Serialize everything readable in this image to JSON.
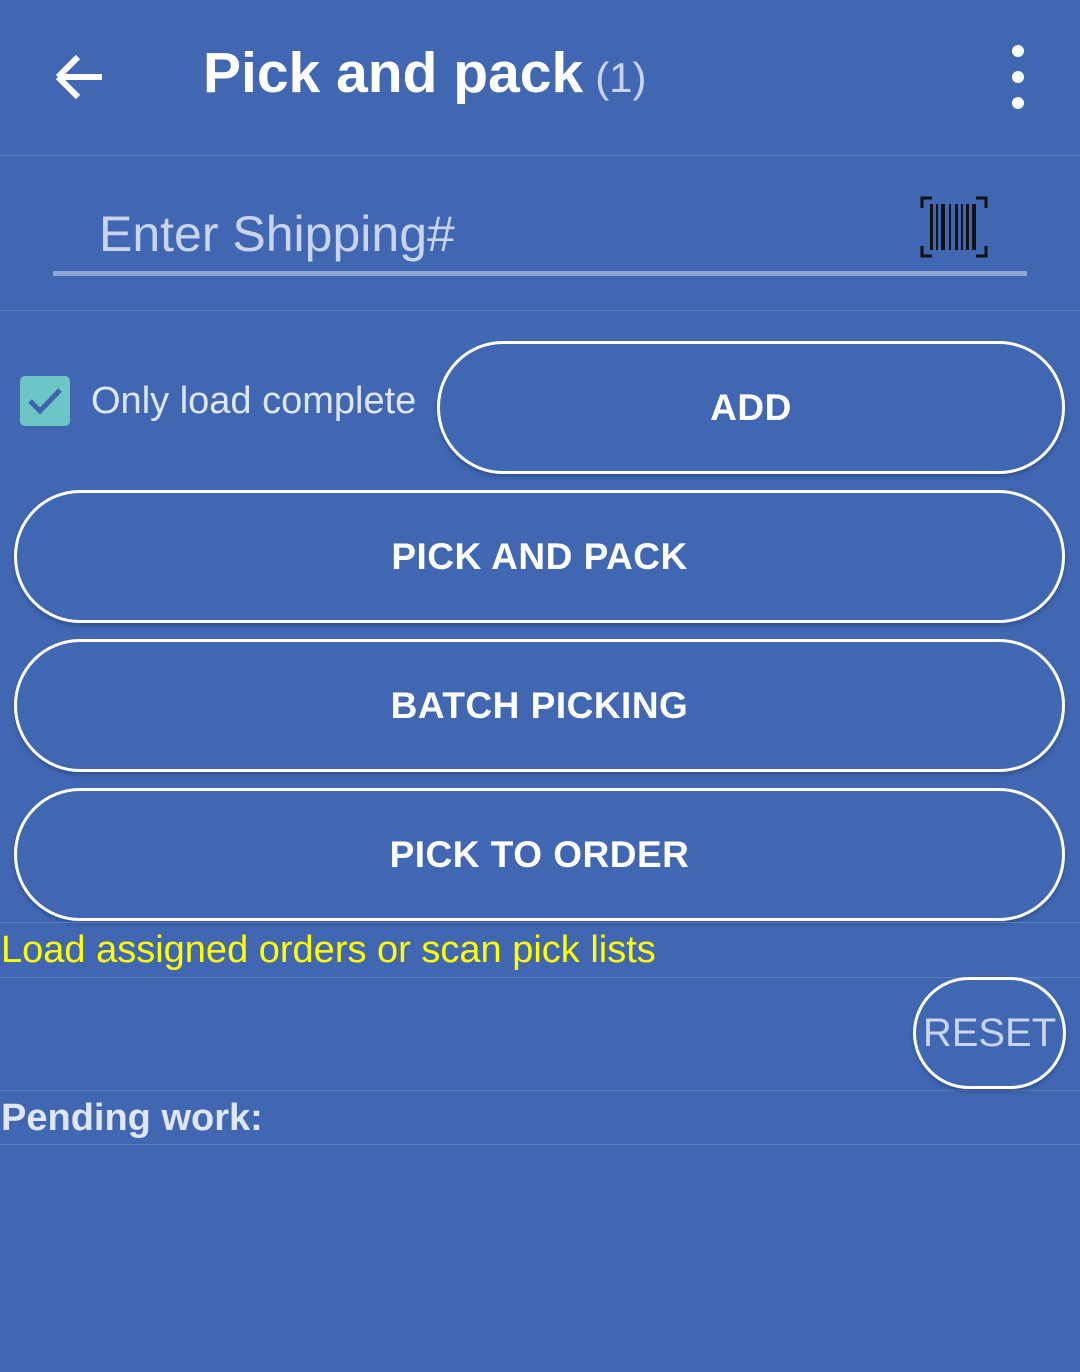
{
  "header": {
    "title": "Pick and pack",
    "count": "(1)",
    "back_icon": "back-arrow-icon",
    "menu_icon": "more-vertical-icon"
  },
  "shipping": {
    "placeholder": "Enter Shipping#",
    "value": "",
    "scan_icon": "barcode-icon"
  },
  "options": {
    "only_load_complete_label": "Only load complete",
    "only_load_complete_checked": true
  },
  "buttons": {
    "add": "ADD",
    "pick_and_pack": "PICK AND PACK",
    "batch_picking": "BATCH PICKING",
    "pick_to_order": "PICK TO ORDER",
    "reset": "RESET"
  },
  "status": {
    "hint": "Load assigned orders or scan pick lists",
    "pending_label": "Pending work:"
  },
  "colors": {
    "background": "#4267b2",
    "hint_text": "#ffff00",
    "checkbox": "#6ec5c6"
  }
}
